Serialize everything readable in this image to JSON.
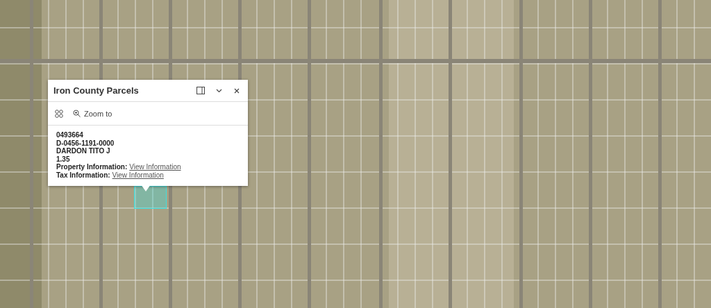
{
  "popup": {
    "title": "Iron County Parcels",
    "actions": [
      {
        "label": "Zoom to"
      }
    ],
    "lines": [
      {
        "kind": "text",
        "text": "0493664"
      },
      {
        "kind": "text",
        "text": "D-0456-1191-0000"
      },
      {
        "kind": "text",
        "text": "DARDON TITO J"
      },
      {
        "kind": "text",
        "text": "1.35"
      },
      {
        "kind": "link",
        "label": "Property Information:",
        "link": "View Information"
      },
      {
        "kind": "link",
        "label": "Tax Information:",
        "link": "View Information"
      }
    ]
  }
}
